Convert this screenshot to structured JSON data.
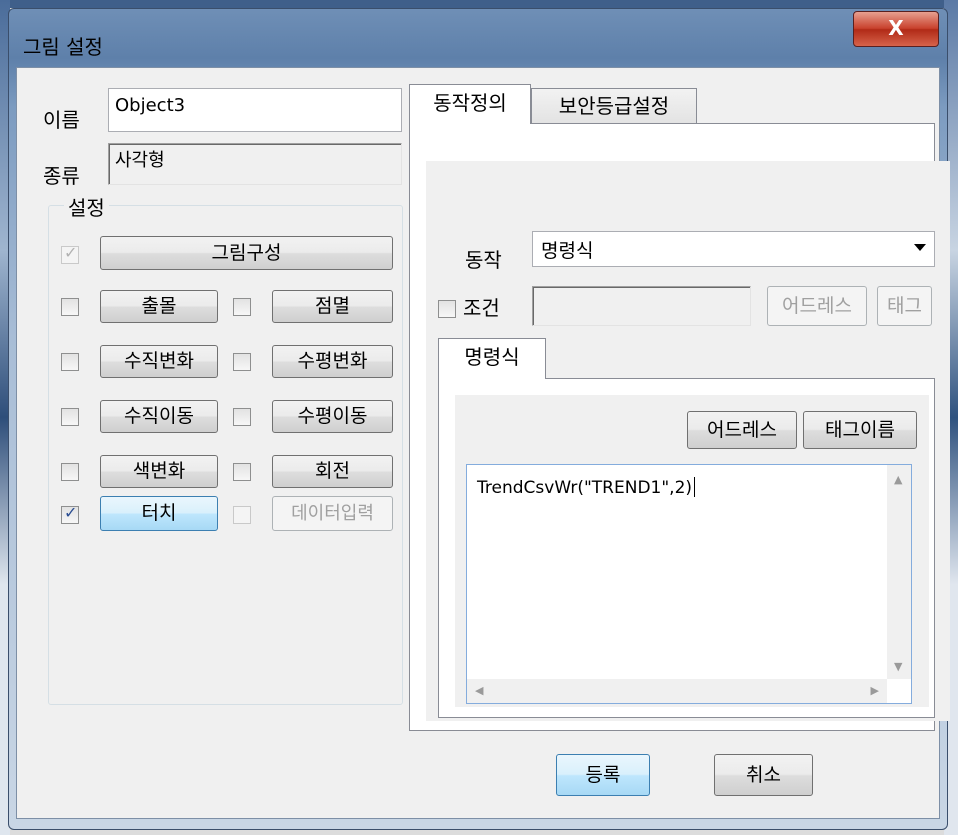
{
  "window": {
    "title": "그림 설정",
    "close_label": "X"
  },
  "name_field": {
    "label": "이름",
    "value": "Object3"
  },
  "type_field": {
    "label": "종류",
    "value": "사각형"
  },
  "settings": {
    "label": "설정",
    "image_config": {
      "label": "그림구성",
      "checked": true,
      "enabled": false
    },
    "items": [
      {
        "label": "출몰",
        "checked": false
      },
      {
        "label": "점멸",
        "checked": false
      },
      {
        "label": "수직변화",
        "checked": false
      },
      {
        "label": "수평변화",
        "checked": false
      },
      {
        "label": "수직이동",
        "checked": false
      },
      {
        "label": "수평이동",
        "checked": false
      },
      {
        "label": "색변화",
        "checked": false
      },
      {
        "label": "회전",
        "checked": false
      },
      {
        "label": "터치",
        "checked": true
      },
      {
        "label": "데이터입력",
        "checked": false,
        "enabled": false
      }
    ]
  },
  "tabs": {
    "action_def": "동작정의",
    "security": "보안등급설정"
  },
  "action": {
    "label": "동작",
    "selected": "명령식",
    "condition": {
      "label": "조건",
      "checked": false,
      "value": ""
    },
    "address_button": "어드레스",
    "tag_button": "태그"
  },
  "command_tab": {
    "label": "명령식",
    "address_button": "어드레스",
    "tagname_button": "태그이름",
    "code": "TrendCsvWr(\"TREND1\",2)"
  },
  "footer": {
    "register": "등록",
    "cancel": "취소"
  }
}
